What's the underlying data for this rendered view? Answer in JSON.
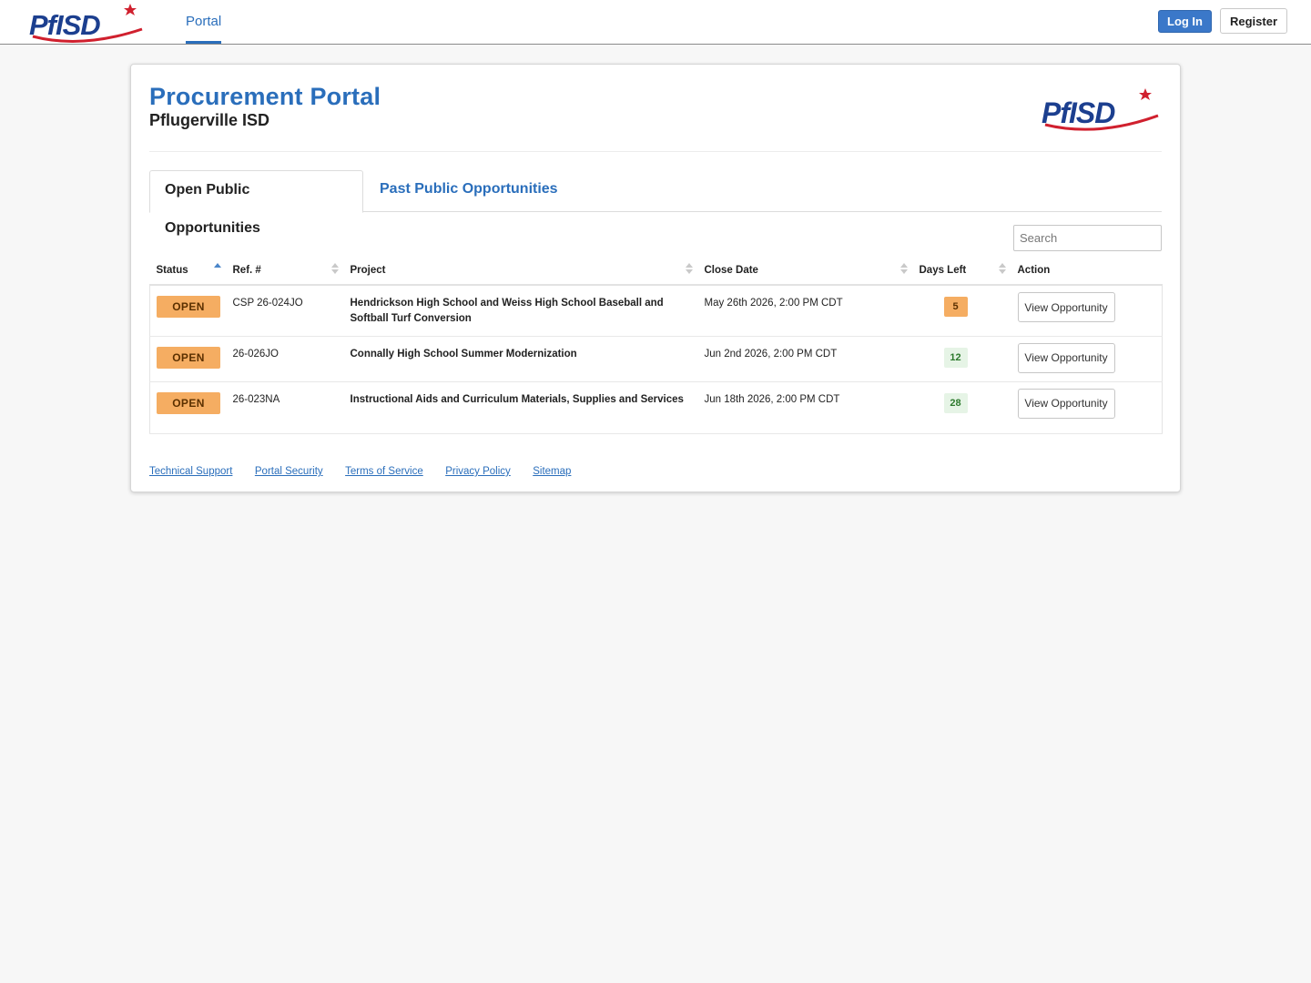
{
  "nav": {
    "logo_text": "PfISD",
    "portal_label": "Portal",
    "login_label": "Log In",
    "register_label": "Register"
  },
  "header": {
    "title": "Procurement Portal",
    "subtitle": "Pflugerville ISD",
    "logo_text": "PfISD"
  },
  "tabs": [
    {
      "label": "Open Public Opportunities",
      "active": true
    },
    {
      "label": "Past Public Opportunities",
      "active": false
    }
  ],
  "search": {
    "placeholder": "Search",
    "value": ""
  },
  "table": {
    "columns": [
      "Status",
      "Ref. #",
      "Project",
      "Close Date",
      "Days Left",
      "Action"
    ],
    "sorted_column": "Status",
    "sort_direction": "ascending",
    "rows": [
      {
        "status": "OPEN",
        "ref": "CSP 26-024JO",
        "project": "Hendrickson High School and Weiss High School Baseball and Softball Turf Conversion",
        "close_date": "May 26th 2026, 2:00 PM CDT",
        "days_left": "5",
        "action": "View Opportunity"
      },
      {
        "status": "OPEN",
        "ref": "26-026JO",
        "project": "Connally High School Summer Modernization",
        "close_date": "Jun 2nd 2026, 2:00 PM CDT",
        "days_left": "12",
        "action": "View Opportunity"
      },
      {
        "status": "OPEN",
        "ref": "26-023NA",
        "project": "Instructional Aids and Curriculum Materials, Supplies and Services",
        "close_date": "Jun 18th 2026, 2:00 PM CDT",
        "days_left": "28",
        "action": "View Opportunity"
      }
    ]
  },
  "footer": {
    "links": [
      "Technical Support",
      "Portal Security",
      "Terms of Service",
      "Privacy Policy",
      "Sitemap"
    ]
  },
  "colors": {
    "brand_blue": "#2a6ebb",
    "logo_navy": "#1c3f8f",
    "logo_red": "#d0202e",
    "status_open": "#f5ad62",
    "days_ok_bg": "#e6f4e6",
    "days_ok_text": "#2d7a2d",
    "login_bg": "#3b78c9"
  }
}
